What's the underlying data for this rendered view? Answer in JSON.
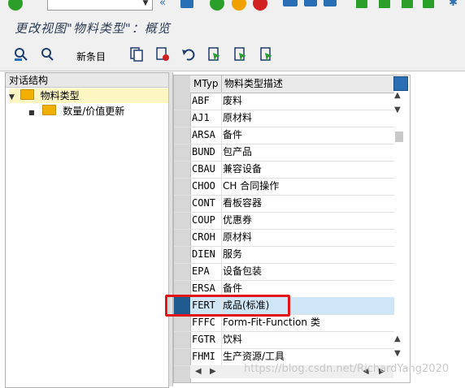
{
  "title": "更改视图\"物料类型\"：概览",
  "toolbar": {
    "new_entries_label": "新条目"
  },
  "tree": {
    "header": "对话结构",
    "items": [
      {
        "label": "物料类型",
        "level": 0,
        "selected": true
      },
      {
        "label": "数量/价值更新",
        "level": 1,
        "selected": false
      }
    ]
  },
  "table": {
    "columns": [
      "MTyp",
      "物料类型描述"
    ],
    "rows": [
      {
        "code": "ABF",
        "desc": "废料"
      },
      {
        "code": "AJ1",
        "desc": "原材料"
      },
      {
        "code": "ARSA",
        "desc": "备件"
      },
      {
        "code": "BUND",
        "desc": "包产品"
      },
      {
        "code": "CBAU",
        "desc": "兼容设备"
      },
      {
        "code": "CHOO",
        "desc": "CH 合同操作"
      },
      {
        "code": "CONT",
        "desc": "看板容器"
      },
      {
        "code": "COUP",
        "desc": "优惠券"
      },
      {
        "code": "CROH",
        "desc": "原材料"
      },
      {
        "code": "DIEN",
        "desc": "服务"
      },
      {
        "code": "EPA",
        "desc": "设备包装"
      },
      {
        "code": "ERSA",
        "desc": "备件"
      },
      {
        "code": "FERT",
        "desc": "成品(标准)",
        "selected": true
      },
      {
        "code": "FFFC",
        "desc": "Form-Fit-Function 类"
      },
      {
        "code": "FGTR",
        "desc": "饮料"
      },
      {
        "code": "FHMI",
        "desc": "生产资源/工具"
      }
    ]
  },
  "watermark": "https://blog.csdn.net/RichardYang2020",
  "colors": {
    "selected_row": "#cfe6f6",
    "highlight_box": "#e2151a",
    "folder": "#f2b100"
  }
}
